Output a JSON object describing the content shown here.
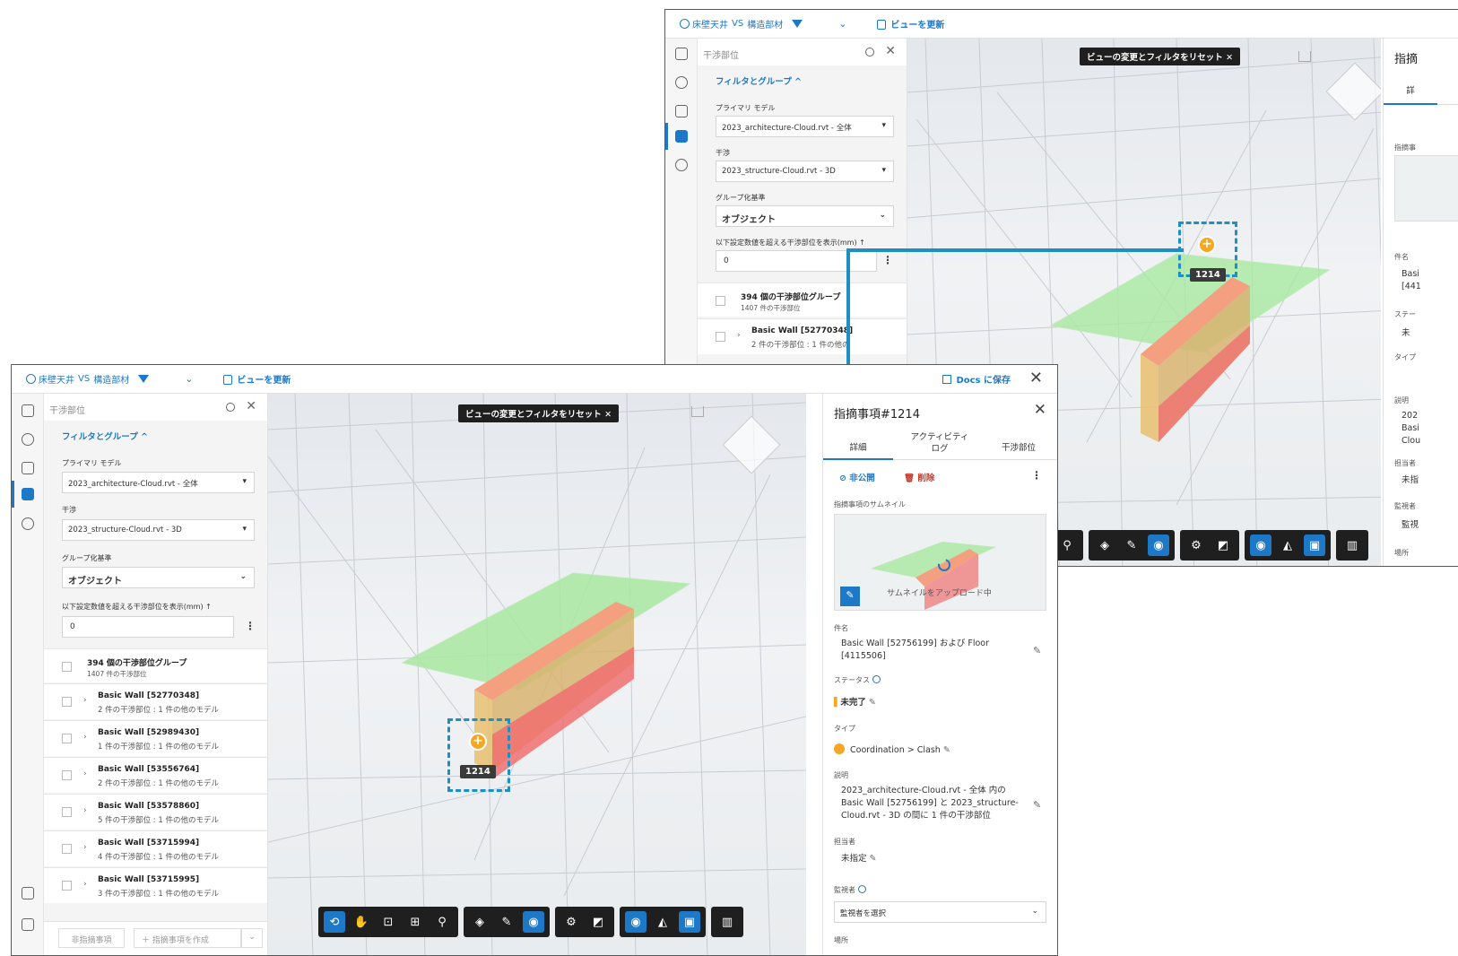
{
  "topbar": {
    "model_a": "床壁天井",
    "vs": "VS",
    "model_b": "構造部材",
    "refresh": "ビューを更新",
    "save": "Docs に保存"
  },
  "left_panel": {
    "title": "干渉部位",
    "filter_group": "フィルタとグループ ^",
    "primary_model_label": "プライマリ モデル",
    "primary_model_value": "2023_architecture-Cloud.rvt - 全体",
    "interference_label": "干渉",
    "interference_value": "2023_structure-Cloud.rvt - 3D",
    "grouping_label": "グループ化基準",
    "grouping_value": "オブジェクト",
    "threshold_label": "以下設定数値を超える干渉部位を表示(mm) ↑",
    "threshold_value": "0",
    "summary_title": "394 個の干渉部位グループ",
    "summary_sub": "1407 件の干渉部位",
    "groups": [
      {
        "name": "Basic Wall [52770348]",
        "detail": "2 件の干渉部位 : 1 件の他のモデル"
      },
      {
        "name": "Basic Wall [52989430]",
        "detail": "1 件の干渉部位 : 1 件の他のモデル"
      },
      {
        "name": "Basic Wall [53556764]",
        "detail": "2 件の干渉部位 : 1 件の他のモデル"
      },
      {
        "name": "Basic Wall [53578860]",
        "detail": "5 件の干渉部位 : 1 件の他のモデル"
      },
      {
        "name": "Basic Wall [53715994]",
        "detail": "4 件の干渉部位 : 1 件の他のモデル"
      },
      {
        "name": "Basic Wall [53715995]",
        "detail": "3 件の干渉部位 : 1 件の他のモデル"
      }
    ],
    "footer_hide": "非指摘事項",
    "footer_create": "指摘事項を作成"
  },
  "viewport": {
    "reset_label": "ビューの変更とフィルタをリセット ✕",
    "pin_number": "1214"
  },
  "right_panel": {
    "title": "指摘事項#1214",
    "tab_detail": "詳細",
    "tab_activity": "アクティビティ\nログ",
    "tab_clash": "干渉部位",
    "private": "非公開",
    "delete": "削除",
    "thumb_label": "指摘事項のサムネイル",
    "uploading": "サムネイルをアップロード中",
    "name_label": "件名",
    "name_value": "Basic Wall [52756199] および Floor [4115506]",
    "status_label": "ステータス",
    "status_value": "未完了",
    "type_label": "タイプ",
    "type_value": "Coordination > Clash",
    "desc_label": "説明",
    "desc_value": "2023_architecture-Cloud.rvt - 全体 内の Basic Wall [52756199] と 2023_structure-Cloud.rvt - 3D の間に 1 件の干渉部位",
    "assignee_label": "担当者",
    "assignee_value": "未指定",
    "watcher_label": "監視者",
    "watcher_placeholder": "監視者を選択",
    "location_label": "場所"
  },
  "back_right_panel": {
    "title_fragment": "指摘",
    "tab_fragment": "詳",
    "thumb_fragment": "指摘事",
    "name_fragment_1": "Basi",
    "name_fragment_2": "[441",
    "status_fragment": "ステー",
    "status_value_fragment": "未",
    "type_fragment": "タイプ",
    "desc_fragment": "説明",
    "desc_line_1": "202",
    "desc_line_2": "Basi",
    "desc_line_3": "Clou",
    "assignee_fragment": "担当者",
    "assignee_value_fragment": "未指",
    "watcher_fragment": "監視者",
    "watcher_value_fragment": "監視",
    "location_fragment": "場所"
  },
  "back_left_panel": {
    "group_1_detail": "2 件の干渉部位 : 1 件の他の"
  },
  "colors": {
    "accent": "#1e78c8",
    "callout": "#1e8fc4",
    "pin": "#f5a623"
  }
}
